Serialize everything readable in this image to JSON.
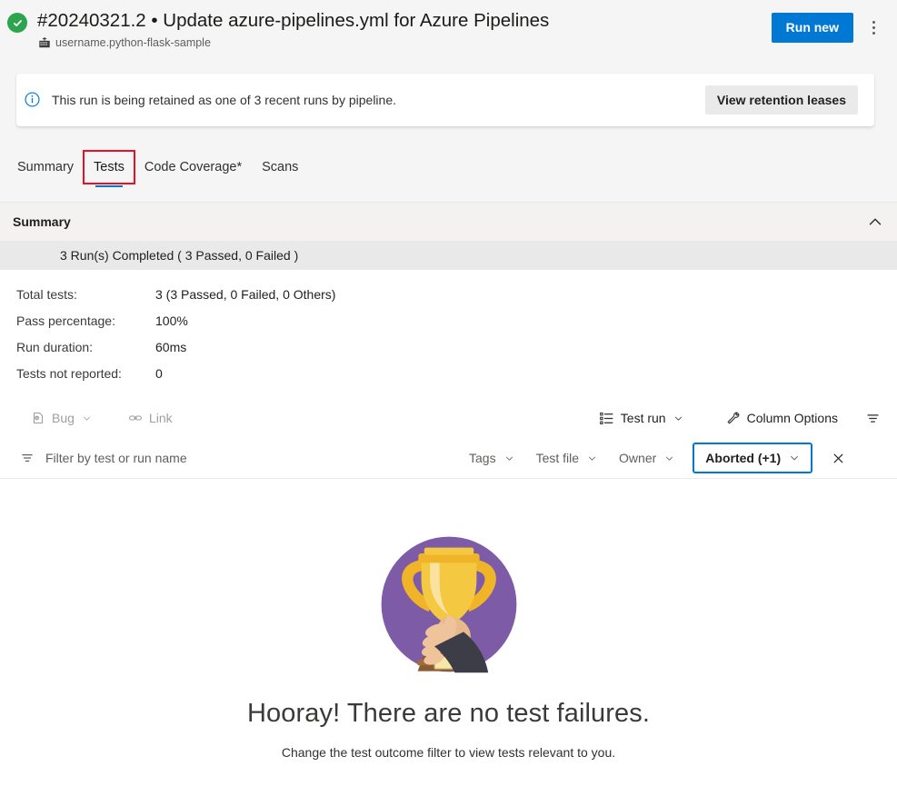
{
  "header": {
    "status_icon": "check-circle-icon",
    "title": "#20240321.2 • Update azure-pipelines.yml for Azure Pipelines",
    "repo_icon": "repository-icon",
    "repo_name": "username.python-flask-sample",
    "run_new_label": "Run new",
    "more_actions_label": "More actions",
    "accent_color": "#0078d4",
    "success_color": "#2da44e"
  },
  "banner": {
    "icon": "info-icon",
    "message": "This run is being retained as one of 3 recent runs by pipeline.",
    "action_label": "View retention leases"
  },
  "tabs": [
    {
      "label": "Summary",
      "selected": false,
      "highlighted": false
    },
    {
      "label": "Tests",
      "selected": true,
      "highlighted": true
    },
    {
      "label": "Code Coverage*",
      "selected": false,
      "highlighted": false
    },
    {
      "label": "Scans",
      "selected": false,
      "highlighted": false
    }
  ],
  "summary": {
    "header_title": "Summary",
    "collapse_icon": "chevron-up-icon",
    "runs_line": "3 Run(s) Completed ( 3 Passed, 0 Failed )",
    "stats": [
      {
        "label": "Total tests:",
        "value": "3 (3 Passed, 0 Failed, 0 Others)"
      },
      {
        "label": "Pass percentage:",
        "value": "100%"
      },
      {
        "label": "Run duration:",
        "value": "60ms"
      },
      {
        "label": "Tests not reported:",
        "value": "0"
      }
    ]
  },
  "toolbar": {
    "bug_label": "Bug",
    "bug_icon": "bug-icon",
    "link_label": "Link",
    "link_icon": "link-icon",
    "test_run_label": "Test run",
    "test_run_icon": "grouping-icon",
    "column_options_label": "Column Options",
    "column_options_icon": "wrench-icon",
    "filter_toggle_icon": "filter-icon"
  },
  "filters": {
    "search_icon": "filter-icon",
    "search_value": "",
    "search_placeholder": "Filter by test or run name",
    "tags_label": "Tags",
    "test_file_label": "Test file",
    "owner_label": "Owner",
    "outcome_label": "Aborted (+1)",
    "clear_icon": "close-icon",
    "focus_color": "#0078d4"
  },
  "empty_state": {
    "illustration": "trophy-illustration",
    "title": "Hooray! There are no test failures.",
    "subtitle": "Change the test outcome filter to view tests relevant to you.",
    "circle_color": "#7d5ba6",
    "trophy_color": "#f5c842",
    "base_color": "#8a5a33"
  }
}
